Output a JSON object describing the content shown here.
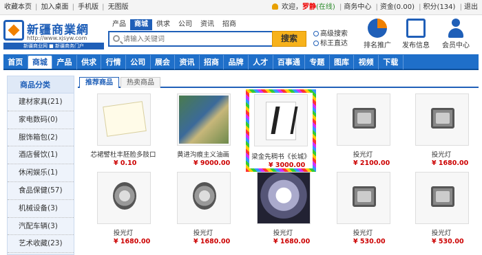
{
  "topbar": {
    "left": [
      "收藏本页",
      "加入桌面",
      "手机版",
      "无图版"
    ],
    "welcome": "欢迎，",
    "username": "罗静",
    "online": "(在线)",
    "links": [
      "商务中心",
      "资金(0.00)",
      "积分(134)",
      "退出"
    ]
  },
  "logo": {
    "name": "新疆商業網",
    "url": "http://www.xjsyw.com",
    "slogan": "新疆商业网 ■ 新疆商务门户"
  },
  "search": {
    "tabs": [
      "产品",
      "商城",
      "供求",
      "公司",
      "资讯",
      "招商"
    ],
    "active_tab": "商城",
    "placeholder": "请输入关键词",
    "button": "搜索",
    "advanced": "高级搜索",
    "extra": "标王直达"
  },
  "quick": [
    {
      "label": "排名推广",
      "icon": "pie-chart-icon"
    },
    {
      "label": "发布信息",
      "icon": "monitor-icon"
    },
    {
      "label": "会员中心",
      "icon": "user-icon"
    }
  ],
  "nav": [
    "首页",
    "商城",
    "产品",
    "供求",
    "行情",
    "公司",
    "展会",
    "资讯",
    "招商",
    "品牌",
    "人才",
    "百事通",
    "专题",
    "图库",
    "视频",
    "下载"
  ],
  "nav_active": "商城",
  "sidebar": {
    "title": "商品分类",
    "items": [
      "建材家具(21)",
      "家电数码(0)",
      "服饰箱包(2)",
      "酒店餐饮(1)",
      "休闲娱乐(1)",
      "食品保健(57)",
      "机械设备(3)",
      "汽配车辆(3)",
      "艺术收藏(23)"
    ]
  },
  "tabs": [
    "推荐商品",
    "热卖商品"
  ],
  "active_tab": "推荐商品",
  "products": [
    {
      "title": "芯裙譬杜丰胚脸多肢口",
      "price": "¥ 0.10",
      "img": "certificate"
    },
    {
      "title": "黄进沟痕主义油画",
      "price": "¥ 9000.00",
      "img": "painting"
    },
    {
      "title": "梁金先稠书《长城》",
      "price": "¥ 3000.00",
      "img": "calligraphy"
    },
    {
      "title": "投光灯",
      "price": "¥ 2100.00",
      "img": "lamp"
    },
    {
      "title": "投光灯",
      "price": "¥ 1680.00",
      "img": "lamp"
    },
    {
      "title": "投光灯",
      "price": "¥ 1680.00",
      "img": "lamp-round"
    },
    {
      "title": "投光灯",
      "price": "¥ 1680.00",
      "img": "lamp-round"
    },
    {
      "title": "投光灯",
      "price": "¥ 1680.00",
      "img": "floodlight-hood"
    },
    {
      "title": "投光灯",
      "price": "¥ 530.00",
      "img": "lamp"
    },
    {
      "title": "投光灯",
      "price": "¥ 530.00",
      "img": "lamp"
    }
  ]
}
